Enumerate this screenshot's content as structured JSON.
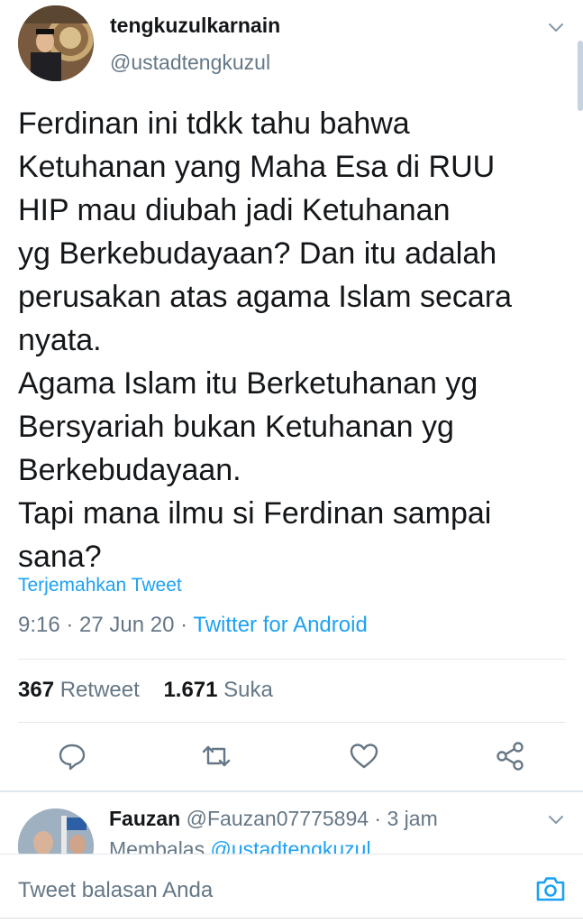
{
  "tweet": {
    "author": {
      "display_name": "tengkuzulkarnain",
      "handle": "@ustadtengkuzul"
    },
    "text": "Ferdinan ini tdkk tahu bahwa\nKetuhanan yang Maha Esa di RUU\nHIP mau diubah jadi Ketuhanan\nyg Berkebudayaan? Dan itu adalah\nperusakan atas agama Islam secara\nnyata.\nAgama Islam itu Berketuhanan yg\nBersyariah bukan Ketuhanan yg\nBerkebudayaan.\nTapi mana ilmu si Ferdinan sampai\nsana?",
    "translate_label": "Terjemahkan Tweet",
    "time": "9:16",
    "date": "27 Jun 20",
    "separator": " · ",
    "source": "Twitter for Android",
    "stats": {
      "retweets": "367",
      "retweets_label": "Retweet",
      "likes": "1.671",
      "likes_label": "Suka"
    }
  },
  "actions": {
    "icons": [
      "reply-icon",
      "retweet-icon",
      "like-icon",
      "share-icon"
    ]
  },
  "reply": {
    "name": "Fauzan",
    "handle": "@Fauzan07775894",
    "time_sep": " · ",
    "time": "3 jam",
    "replying_prefix": "Membalas ",
    "replying_to": "@ustadtengkuzul"
  },
  "composer": {
    "placeholder": "Tweet balasan Anda"
  },
  "colors": {
    "accent": "#1da1f2",
    "secondary_text": "#657786",
    "divider": "#e1e8ed",
    "primary_text": "#14171a"
  }
}
